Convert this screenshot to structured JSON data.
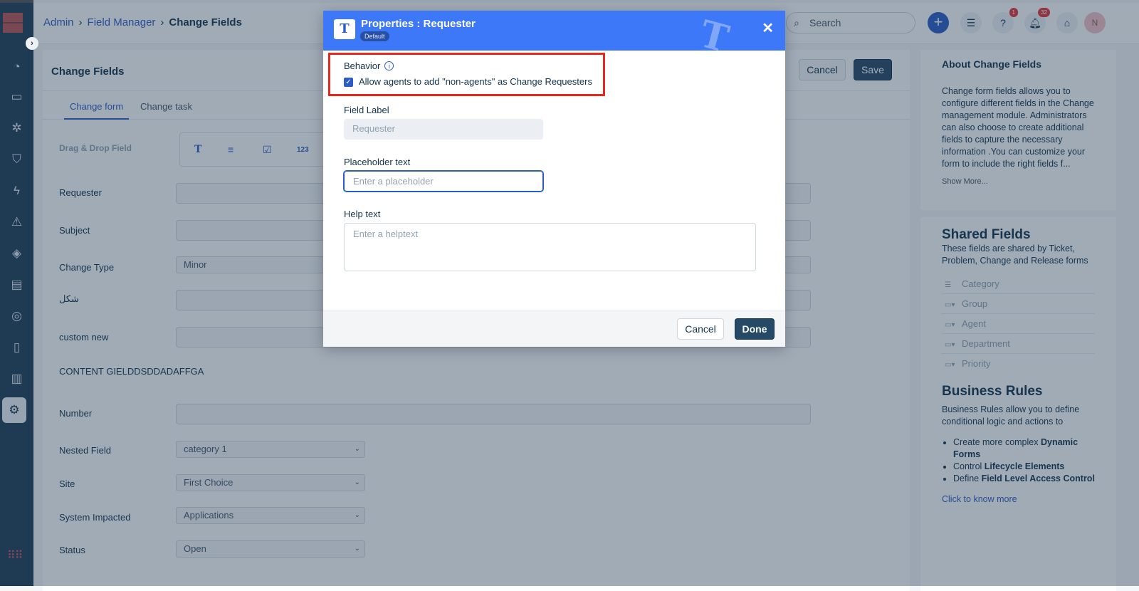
{
  "breadcrumb": {
    "items": [
      "Admin",
      "Field Manager",
      "Change Fields"
    ]
  },
  "header": {
    "search_placeholder": "Search",
    "help_badge": "1",
    "notif_badge": "32",
    "avatar_initial": "N"
  },
  "page": {
    "title": "Change Fields",
    "cancel_label": "Cancel",
    "save_label": "Save",
    "tabs": [
      {
        "label": "Change form",
        "active": true
      },
      {
        "label": "Change task",
        "active": false
      }
    ],
    "drag_drop_label": "Drag & Drop Field",
    "palette": [
      "T",
      "≡",
      "☑",
      "123"
    ],
    "fields": [
      {
        "label": "Requester",
        "type": "text"
      },
      {
        "label": "Subject",
        "type": "text"
      },
      {
        "label": "Change Type",
        "type": "select",
        "value": "Minor"
      },
      {
        "label": "شكل",
        "type": "text"
      },
      {
        "label": "custom new",
        "type": "text"
      },
      {
        "label": "CONTENT GIELDDSDDADAFFGA",
        "type": "content"
      },
      {
        "label": "Number",
        "type": "text"
      },
      {
        "label": "Nested Field",
        "type": "select",
        "value": "category 1"
      },
      {
        "label": "Site",
        "type": "select",
        "value": "First Choice"
      },
      {
        "label": "System Impacted",
        "type": "select",
        "value": "Applications"
      },
      {
        "label": "Status",
        "type": "select",
        "value": "Open"
      }
    ]
  },
  "right_panel": {
    "about_title": "About Change Fields",
    "about_text": "Change form fields allows you to configure different fields in the Change management module. Administrators can also choose to create additional fields to capture the necessary information .You can customize your form to include the right fields f...",
    "show_more": "Show More...",
    "shared_title": "Shared Fields",
    "shared_text": "These fields are shared by Ticket, Problem, Change and Release forms",
    "shared_items": [
      "Category",
      "Group",
      "Agent",
      "Department",
      "Priority"
    ],
    "rules_title": "Business Rules",
    "rules_text": "Business Rules allow you to define conditional logic and actions to",
    "rules_items": [
      [
        "Create more complex ",
        "Dynamic Forms"
      ],
      [
        "Control ",
        "Lifecycle Elements"
      ],
      [
        "Define ",
        "Field Level Access Control"
      ]
    ],
    "rules_link": "Click to know more"
  },
  "modal": {
    "title": "Properties : Requester",
    "badge": "Default",
    "behavior_label": "Behavior",
    "checkbox_label": "Allow agents to add \"non-agents\" as Change Requesters",
    "checkbox_checked": true,
    "field_label_label": "Field Label",
    "field_label_value": "Requester",
    "placeholder_label": "Placeholder text",
    "placeholder_placeholder": "Enter a placeholder",
    "help_label": "Help text",
    "help_placeholder": "Enter a helptext",
    "cancel_label": "Cancel",
    "done_label": "Done"
  },
  "colors": {
    "modal_header": "#3c78f7",
    "primary": "#264966",
    "highlight": "#e8281f",
    "link": "#2c5cc5"
  }
}
